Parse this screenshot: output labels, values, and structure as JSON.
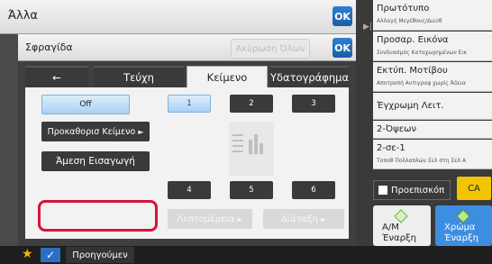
{
  "top": {
    "title": "Άλλα",
    "ok_label": "OK"
  },
  "dialog": {
    "title": "Σφραγίδα",
    "cancel_all": "Ακύρωση Όλων",
    "ok_label": "OK",
    "tabs": [
      {
        "label": "←"
      },
      {
        "label": "Τεύχη"
      },
      {
        "label": "Κείμενο",
        "active": true
      },
      {
        "label": "Υδατογράφημα"
      }
    ],
    "off_label": "Off",
    "preset_text_label": "Προκαθορισ Κείμενο",
    "direct_entry_label": "Άμεση Εισαγωγή",
    "positions_top": [
      "1",
      "2",
      "3"
    ],
    "positions_bottom": [
      "4",
      "5",
      "6"
    ],
    "details_label": "Λεπτομέρεια",
    "layout_label": "Διάταξη"
  },
  "right_column": [
    {
      "main": "Πρωτότυπο",
      "sub": "Αλλαγή Μεγέθους/Διεύθ"
    },
    {
      "main": "Προσαρ. Εικόνα",
      "sub": "Συνδυασμός Καταχωρημένων Εικ"
    },
    {
      "main": "Εκτύπ. Μοτίβου",
      "sub": "Αποτροπή Αντιγραφ χωρίς Άδεια"
    },
    {
      "main": "Έγχρωμη Λειτ.",
      "sub": ""
    },
    {
      "main": "2-Όψεων",
      "sub": ""
    },
    {
      "main": "2-σε-1",
      "sub": "Τοποθ Πολλαπλών Σελ στη Σελ Α"
    }
  ],
  "preview_label": "Προεπισκόπ",
  "ca_label": "CA",
  "start_bw": {
    "line1": "Α/Μ",
    "line2": "Έναρξη"
  },
  "start_color": {
    "line1": "Χρώμα",
    "line2": "Έναρξη"
  },
  "bottom": {
    "prev_label": "Προηγούμεν"
  },
  "colors": {
    "accent_blue": "#1a5da8",
    "highlight_red": "#d9123a",
    "ca_yellow": "#f2c500",
    "start_color_blue": "#3d8ee0"
  }
}
